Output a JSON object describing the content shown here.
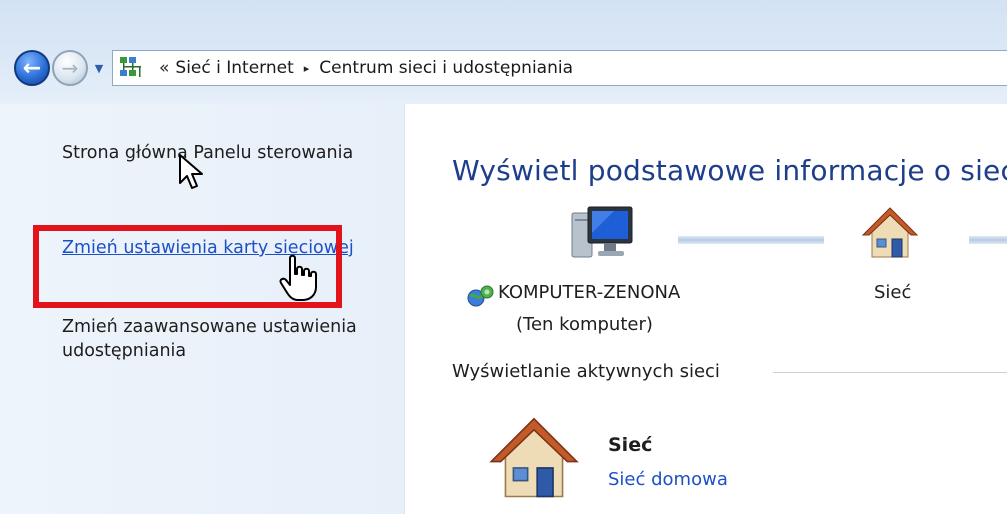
{
  "navigation": {
    "back_icon": "back-arrow-icon",
    "forward_icon": "forward-arrow-icon",
    "history_icon": "chevron-down-icon",
    "address_icon": "network-icon",
    "breadcrumb_prefix": "«",
    "breadcrumb": [
      "Sieć i Internet",
      "Centrum sieci i udostępniania"
    ],
    "breadcrumb_separator": "▸"
  },
  "sidebar": {
    "tasks": [
      {
        "label": "Strona główna Panelu sterowania"
      },
      {
        "label": "Zmień ustawienia karty sieciowej"
      },
      {
        "label": "Zmień zaawansowane ustawienia udostępniania"
      }
    ],
    "highlight_color": "#e3131b"
  },
  "main": {
    "title": "Wyświetl podstawowe informacje o sieci",
    "computer": {
      "name": "KOMPUTER-ZENONA",
      "subtitle": "(Ten komputer)",
      "icon": "computer-icon"
    },
    "network_node": {
      "label": "Sieć",
      "icon": "house-icon"
    },
    "active_networks_heading": "Wyświetlanie aktywnych sieci",
    "active_network": {
      "name": "Sieć",
      "type": "Sieć domowa",
      "icon": "house-icon"
    }
  },
  "colors": {
    "title": "#1e3e8c",
    "link": "#1c50c8",
    "chrome": "#d3e2f3"
  }
}
